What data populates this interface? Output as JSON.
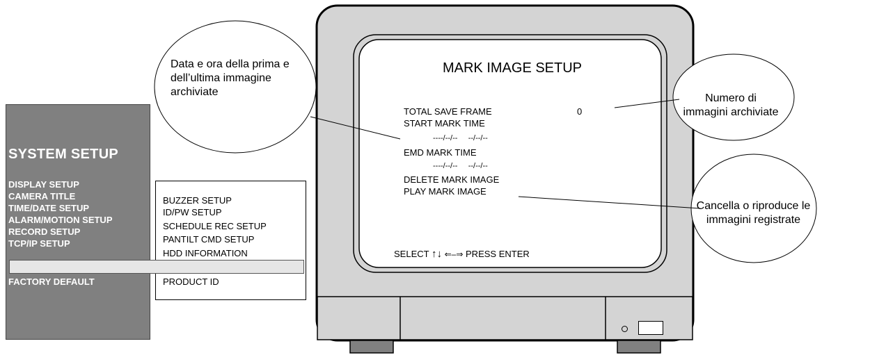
{
  "system_menu": {
    "title": "SYSTEM SETUP",
    "items": [
      "DISPLAY SETUP",
      "CAMERA TITLE",
      "TIME/DATE SETUP",
      "ALARM/MOTION SETUP",
      "RECORD SETUP",
      "TCP/IP SETUP",
      "FACTORY DEFAULT"
    ]
  },
  "sub_menu": {
    "items": [
      "BUZZER SETUP",
      "ID/PW SETUP",
      "SCHEDULE REC SETUP",
      "PANTILT CMD SETUP",
      "HDD INFORMATION",
      "PRODUCT ID"
    ]
  },
  "screen": {
    "title": "MARK IMAGE SETUP",
    "total_save_frame": "TOTAL SAVE FRAME",
    "total_value": "0",
    "start_mark": "START MARK TIME",
    "start_dates": "----/--/--     --/--/--",
    "end_mark": "EMD MARK TIME",
    "end_dates": "----/--/--     --/--/--",
    "delete": "DELETE MARK IMAGE",
    "play": "PLAY MARK IMAGE",
    "select_label": "SELECT",
    "press_enter": "PRESS ENTER"
  },
  "callouts": {
    "dates": "Data e ora della prima e dell’ultima immagine archiviate",
    "count": "Numero di immagini archiviate",
    "actions": "Cancella o riproduce le immagini registrate"
  }
}
